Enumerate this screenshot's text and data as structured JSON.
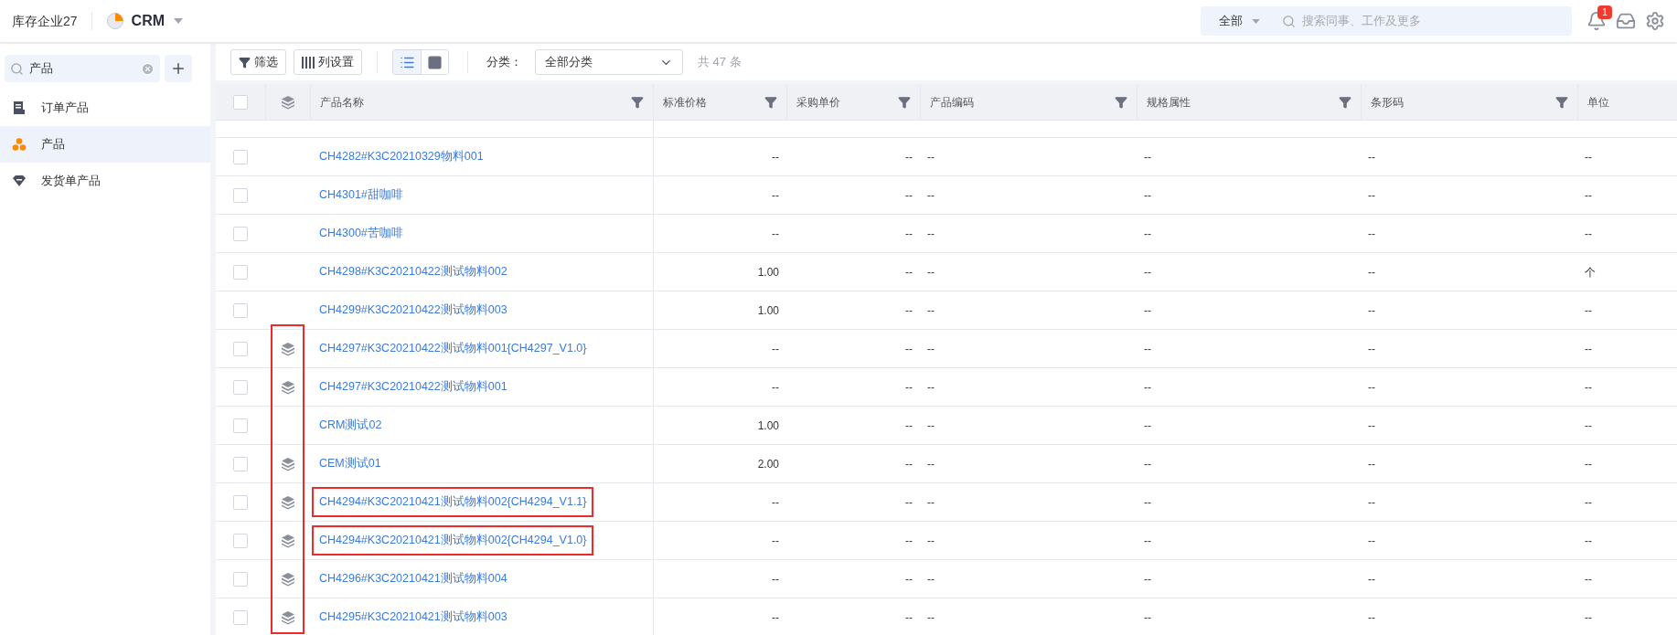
{
  "header": {
    "company": "库存企业27",
    "app_name": "CRM",
    "search_scope": "全部",
    "search_placeholder": "搜索同事、工作及更多",
    "notification_count": "1"
  },
  "sidebar": {
    "search_value": "产品",
    "items": [
      {
        "label": "订单产品",
        "selected": false,
        "kind": "order"
      },
      {
        "label": "产品",
        "selected": true,
        "kind": "product"
      },
      {
        "label": "发货单产品",
        "selected": false,
        "kind": "shipment"
      }
    ]
  },
  "toolbar": {
    "filter_button": "筛选",
    "columns_button": "列设置",
    "views": [
      {
        "kind": "list",
        "selected": true
      },
      {
        "kind": "card",
        "selected": false
      }
    ],
    "category_label": "分类：",
    "category_value": "全部分类",
    "total": "共 47 条"
  },
  "table": {
    "select_all_checked": false,
    "columns": [
      {
        "label": "产品名称",
        "filter": true
      },
      {
        "label": "标准价格",
        "filter": true
      },
      {
        "label": "采购单价",
        "filter": true
      },
      {
        "label": "产品编码",
        "filter": true
      },
      {
        "label": "规格属性",
        "filter": true
      },
      {
        "label": "条形码",
        "filter": true
      },
      {
        "label": "单位",
        "filter": false
      }
    ],
    "rows": [
      {
        "cells": [
          "CH4282#K3C20210329物料001",
          "--",
          "--",
          "--",
          "--",
          "--",
          "--"
        ],
        "checked": false,
        "has_bom": false,
        "marked": false,
        "highlighted": false
      },
      {
        "cells": [
          "CH4301#甜咖啡",
          "--",
          "--",
          "--",
          "--",
          "--",
          "--"
        ],
        "checked": false,
        "has_bom": false,
        "marked": false,
        "highlighted": false
      },
      {
        "cells": [
          "CH4300#苦咖啡",
          "--",
          "--",
          "--",
          "--",
          "--",
          "--"
        ],
        "checked": false,
        "has_bom": false,
        "marked": false,
        "highlighted": false
      },
      {
        "cells": [
          "CH4298#K3C20210422测试物料002",
          "1.00",
          "--",
          "--",
          "--",
          "--",
          "个"
        ],
        "checked": false,
        "has_bom": false,
        "marked": false,
        "highlighted": false
      },
      {
        "cells": [
          "CH4299#K3C20210422测试物料003",
          "1.00",
          "--",
          "--",
          "--",
          "--",
          "--"
        ],
        "checked": false,
        "has_bom": false,
        "marked": false,
        "highlighted": false
      },
      {
        "cells": [
          "CH4297#K3C20210422测试物料001{CH4297_V1.0}",
          "--",
          "--",
          "--",
          "--",
          "--",
          "--"
        ],
        "checked": false,
        "has_bom": true,
        "marked": true,
        "highlighted": false
      },
      {
        "cells": [
          "CH4297#K3C20210422测试物料001",
          "--",
          "--",
          "--",
          "--",
          "--",
          "--"
        ],
        "checked": false,
        "has_bom": true,
        "marked": true,
        "highlighted": false
      },
      {
        "cells": [
          "CRM测试02",
          "1.00",
          "--",
          "--",
          "--",
          "--",
          "--"
        ],
        "checked": false,
        "has_bom": false,
        "marked": true,
        "highlighted": false
      },
      {
        "cells": [
          "CEM测试01",
          "2.00",
          "--",
          "--",
          "--",
          "--",
          "--"
        ],
        "checked": false,
        "has_bom": true,
        "marked": true,
        "highlighted": false
      },
      {
        "cells": [
          "CH4294#K3C20210421测试物料002{CH4294_V1.1}",
          "--",
          "--",
          "--",
          "--",
          "--",
          "--"
        ],
        "checked": false,
        "has_bom": true,
        "marked": true,
        "highlighted": true
      },
      {
        "cells": [
          "CH4294#K3C20210421测试物料002{CH4294_V1.0}",
          "--",
          "--",
          "--",
          "--",
          "--",
          "--"
        ],
        "checked": false,
        "has_bom": true,
        "marked": true,
        "highlighted": true
      },
      {
        "cells": [
          "CH4296#K3C20210421测试物料004",
          "--",
          "--",
          "--",
          "--",
          "--",
          "--"
        ],
        "checked": false,
        "has_bom": true,
        "marked": true,
        "highlighted": false
      },
      {
        "cells": [
          "CH4295#K3C20210421测试物料003",
          "--",
          "--",
          "--",
          "--",
          "--",
          "--"
        ],
        "checked": false,
        "has_bom": true,
        "marked": true,
        "highlighted": false
      }
    ]
  }
}
